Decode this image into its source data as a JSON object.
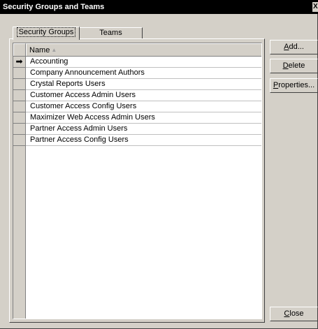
{
  "window": {
    "title": "Security Groups and Teams",
    "close_glyph": "X"
  },
  "tabs": [
    {
      "label": "Security Groups",
      "active": true
    },
    {
      "label": "Teams",
      "active": false
    }
  ],
  "grid": {
    "column_header": "Name",
    "sort_indicator": "▲",
    "current_row_marker": "➡",
    "rows": [
      "Accounting",
      "Company Announcement Authors",
      "Crystal Reports Users",
      "Customer Access Admin Users",
      "Customer Access Config Users",
      "Maximizer Web Access Admin Users",
      "Partner Access Admin Users",
      "Partner Access Config Users"
    ]
  },
  "buttons": {
    "add": {
      "mnemonic": "A",
      "rest": "dd..."
    },
    "delete": {
      "mnemonic": "D",
      "rest": "elete"
    },
    "properties": {
      "mnemonic": "P",
      "rest": "roperties..."
    },
    "close": {
      "mnemonic": "C",
      "rest": "lose"
    }
  }
}
